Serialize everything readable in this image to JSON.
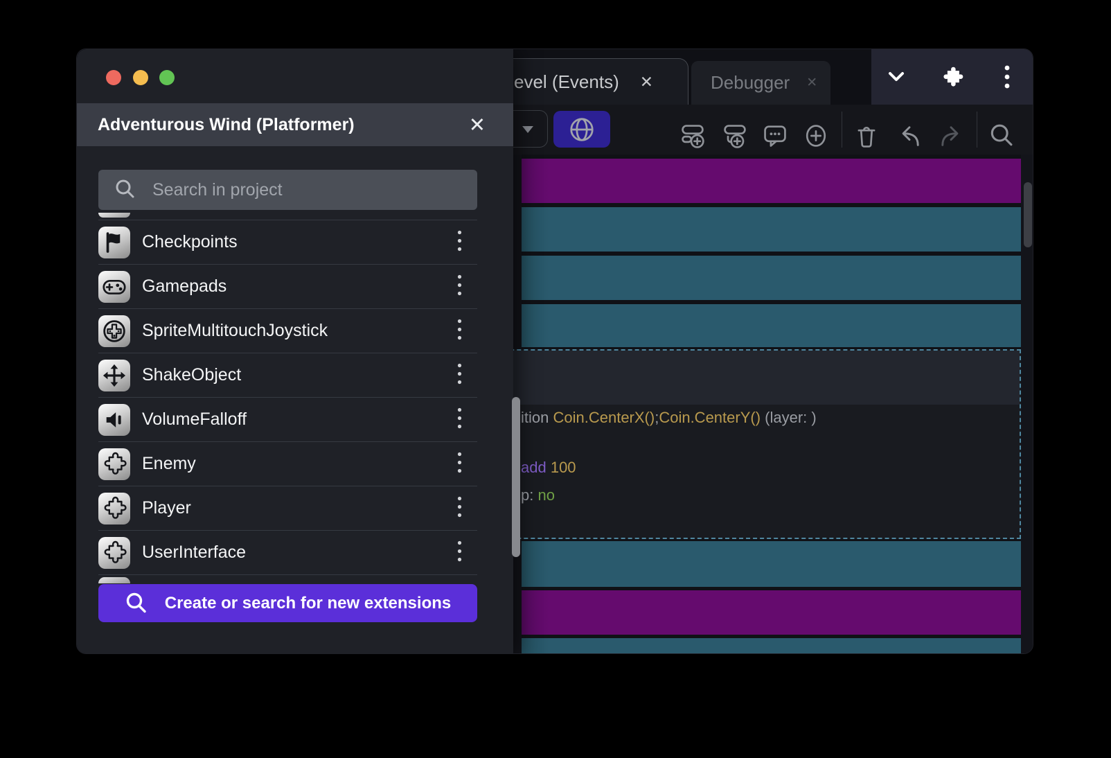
{
  "titlebar": {
    "tabs": [
      {
        "label": "evel (Events)",
        "close_glyph": "✕"
      },
      {
        "label": "Debugger",
        "close_glyph": "✕"
      }
    ]
  },
  "drawer": {
    "title": "Adventurous Wind (Platformer)",
    "close_glyph": "✕",
    "search_placeholder": "Search in project",
    "items": [
      {
        "label": "Checkpoints",
        "icon": "flag-icon"
      },
      {
        "label": "Gamepads",
        "icon": "gamepad-icon"
      },
      {
        "label": "SpriteMultitouchJoystick",
        "icon": "joystick-icon"
      },
      {
        "label": "ShakeObject",
        "icon": "move-icon"
      },
      {
        "label": "VolumeFalloff",
        "icon": "speaker-icon"
      },
      {
        "label": "Enemy",
        "icon": "puzzle-icon"
      },
      {
        "label": "Player",
        "icon": "puzzle-icon"
      },
      {
        "label": "UserInterface",
        "icon": "puzzle-icon"
      }
    ],
    "cta_label": "Create or search for new extensions"
  },
  "events_sheet": {
    "rows": [
      "purple",
      "teal",
      "teal",
      "teal",
      "selected",
      "teal",
      "purple",
      "teal"
    ],
    "selected_event": {
      "line1": [
        {
          "text": "ition ",
          "color": "#9a9da3"
        },
        {
          "text": "Coin.CenterX()",
          "color": "#b99a4e"
        },
        {
          "text": ";",
          "color": "#9a9da3"
        },
        {
          "text": "Coin.CenterY()",
          "color": "#b99a4e"
        },
        {
          "text": " (layer: )",
          "color": "#9a9da3"
        }
      ],
      "line2": [
        {
          "text": "add ",
          "color": "#7e5cc5"
        },
        {
          "text": "100",
          "color": "#b99a4e"
        }
      ],
      "line3": [
        {
          "text": "p: ",
          "color": "#9a9da3"
        },
        {
          "text": "no",
          "color": "#6fa045"
        }
      ]
    }
  },
  "colors": {
    "event_purple": "#650b6e",
    "event_teal": "#2a5a6d",
    "accent_purple": "#5b2fd9",
    "globe_button": "#2c2094",
    "traffic_red": "#ee6a5f",
    "traffic_yellow": "#f5bd4f",
    "traffic_green": "#62c454"
  }
}
